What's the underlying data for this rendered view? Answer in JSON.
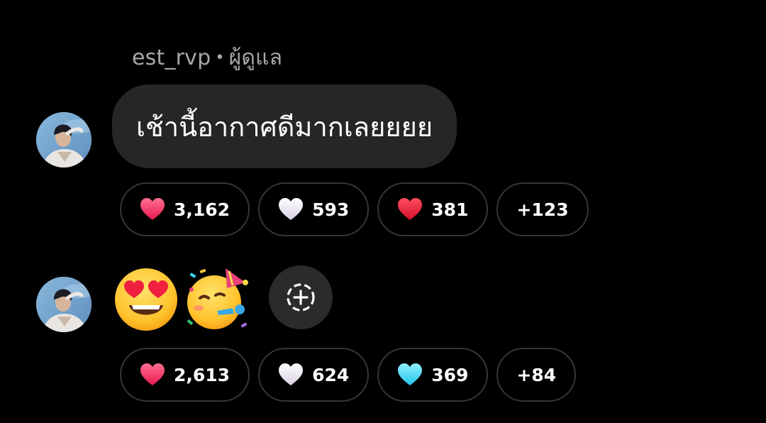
{
  "message_1": {
    "sender": "est_rvp",
    "separator": "•",
    "role": "ผู้ดูแล",
    "text": "เช้านี้อากาศดีมากเลยยยย",
    "reactions": [
      {
        "icon": "heart-pink-icon",
        "color": "#ff3b6b",
        "count": "3,162"
      },
      {
        "icon": "heart-white-icon",
        "color": "#f2eef6",
        "count": "593"
      },
      {
        "icon": "heart-red-icon",
        "color": "#f5233f",
        "count": "381"
      },
      {
        "more": "+123"
      }
    ]
  },
  "message_2": {
    "emojis": [
      "heart-eyes-emoji",
      "partying-face-emoji"
    ],
    "add_reaction_icon": "add-reaction-icon",
    "reactions": [
      {
        "icon": "heart-pink-icon",
        "color": "#ff3b6b",
        "count": "2,613"
      },
      {
        "icon": "heart-white-icon",
        "color": "#f2eef6",
        "count": "624"
      },
      {
        "icon": "heart-cyan-icon",
        "color": "#3ad7f5",
        "count": "369"
      },
      {
        "more": "+84"
      }
    ]
  },
  "colors": {
    "background": "#000000",
    "bubble": "#262626",
    "pill_border": "#363636",
    "meta_text": "#a8a8a8"
  }
}
